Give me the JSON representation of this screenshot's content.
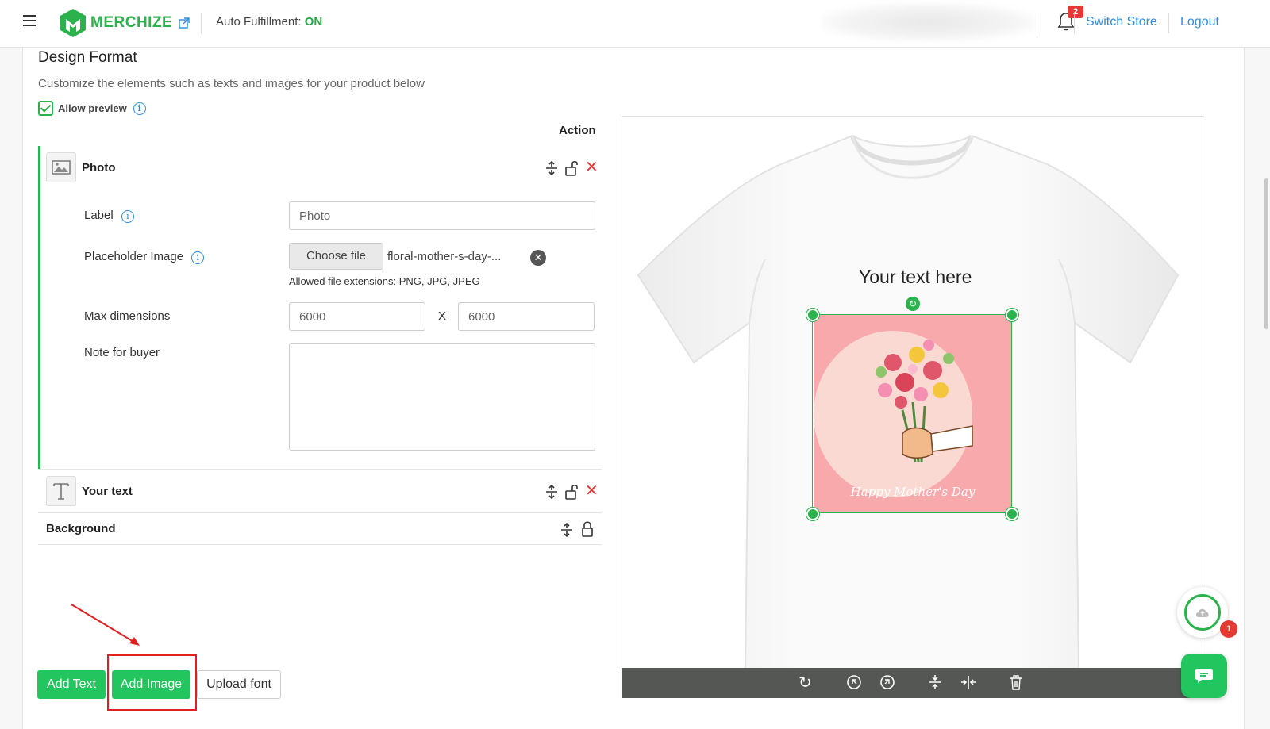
{
  "header": {
    "brand": "MERCHIZE",
    "auto_fulfillment_label": "Auto Fulfillment:",
    "auto_fulfillment_value": "ON",
    "notification_count": "2",
    "switch_store": "Switch Store",
    "logout": "Logout"
  },
  "design_format": {
    "title": "Design Format",
    "subtitle": "Customize the elements such as texts and images for your product below",
    "allow_preview_label": "Allow preview",
    "allow_preview_checked": true,
    "action_header": "Action"
  },
  "layers": {
    "photo": {
      "title": "Photo",
      "label_field_label": "Label",
      "label_value": "Photo",
      "placeholder_image_label": "Placeholder Image",
      "choose_file": "Choose file",
      "file_name": "floral-mother-s-day-...",
      "allowed_extensions": "Allowed file extensions: PNG, JPG, JPEG",
      "max_dimensions_label": "Max dimensions",
      "max_width": "6000",
      "x_separator": "X",
      "max_height": "6000",
      "note_label": "Note for buyer",
      "note_value": ""
    },
    "text": {
      "title": "Your text"
    },
    "background": {
      "title": "Background"
    }
  },
  "buttons": {
    "add_text": "Add Text",
    "add_image": "Add Image",
    "upload_font": "Upload font"
  },
  "preview": {
    "text_layer": "Your text here",
    "image_caption": "Happy Mother's Day",
    "colors": {
      "accent": "#2bb24c",
      "image_bg": "#f7a9ac",
      "toolbar": "#555755"
    }
  },
  "widgets": {
    "cloud_badge": "1"
  },
  "icons": [
    "menu-icon",
    "external-link-icon",
    "bell-icon",
    "info-icon",
    "image-icon",
    "text-icon",
    "move-icon",
    "unlock-icon",
    "lock-icon",
    "close-icon",
    "refresh-icon",
    "rotate-left-icon",
    "rotate-right-icon",
    "align-vertical-icon",
    "align-horizontal-icon",
    "trash-icon",
    "cloud-icon",
    "chat-icon"
  ]
}
